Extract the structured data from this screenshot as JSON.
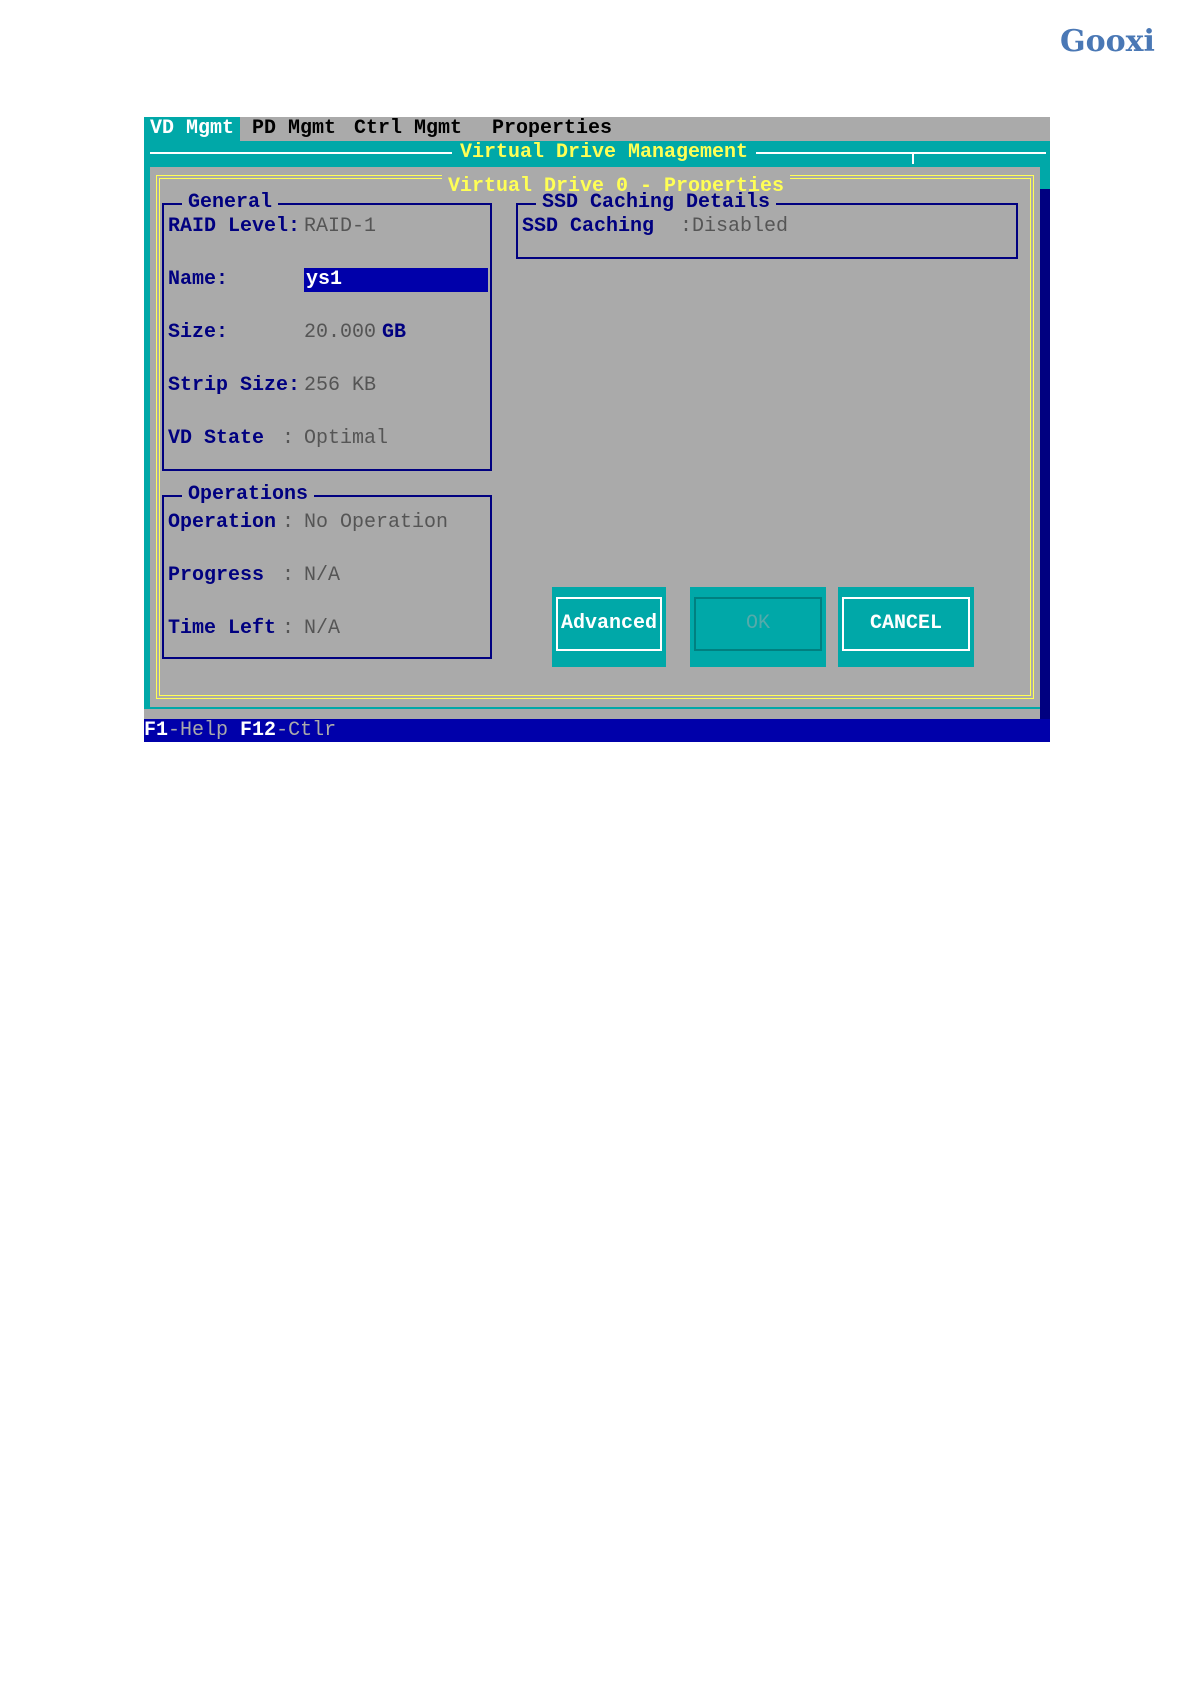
{
  "doc": {
    "logo_text": "Gooxi"
  },
  "menu": {
    "items": [
      {
        "label": "VD Mgmt"
      },
      {
        "label": "PD Mgmt"
      },
      {
        "label": "Ctrl Mgmt"
      },
      {
        "label": "Properties"
      }
    ],
    "active_index": 0
  },
  "window": {
    "title": "Virtual Drive Management",
    "panel_title": "Virtual Drive 0 - Properties"
  },
  "general": {
    "title": "General",
    "raid_level_label": "RAID Level:",
    "raid_level_value": "RAID-1",
    "name_label": "Name:",
    "name_value": "ys1",
    "size_label": "Size:",
    "size_value": "20.000",
    "size_unit": "GB",
    "strip_size_label": "Strip Size:",
    "strip_size_value": "256 KB",
    "vd_state_label": "VD State",
    "vd_state_sep": ":",
    "vd_state_value": "Optimal"
  },
  "operations": {
    "title": "Operations",
    "operation_label": "Operation",
    "operation_sep": ":",
    "operation_value": "No Operation",
    "progress_label": "Progress",
    "progress_sep": ":",
    "progress_value": "N/A",
    "time_left_label": "Time Left",
    "time_left_sep": ":",
    "time_left_value": "N/A"
  },
  "ssd": {
    "title": "SSD Caching Details",
    "caching_label": "SSD Caching",
    "caching_value": ":Disabled"
  },
  "buttons": {
    "advanced": "Advanced",
    "ok": "OK",
    "cancel": "CANCEL"
  },
  "status": {
    "f1_key": "F1",
    "f1_text": "-Help",
    "f12_key": "F12",
    "f12_text": "-Ctlr"
  },
  "colors": {
    "bios_gray": "#aaaaaa",
    "bios_cyan": "#00a8a8",
    "bios_navy": "#000080",
    "bios_yellow": "#ffff55",
    "logo_blue": "#4a78b5"
  }
}
